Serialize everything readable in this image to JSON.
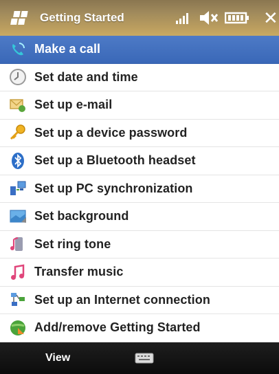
{
  "window": {
    "title": "Getting Started",
    "close_label": "✕"
  },
  "colors": {
    "selected_row": "#3a68b8",
    "title_bar": "#b69a5e",
    "soft_bar": "#111111"
  },
  "list": {
    "selected_index": 0,
    "items": [
      {
        "label": "Make a call",
        "icon": "phone-call-icon"
      },
      {
        "label": "Set date and time",
        "icon": "clock-icon"
      },
      {
        "label": "Set up e-mail",
        "icon": "email-icon"
      },
      {
        "label": "Set up a device password",
        "icon": "key-icon"
      },
      {
        "label": "Set up a Bluetooth headset",
        "icon": "bluetooth-icon"
      },
      {
        "label": "Set up PC synchronization",
        "icon": "pc-sync-icon"
      },
      {
        "label": "Set background",
        "icon": "background-image-icon"
      },
      {
        "label": "Set ring tone",
        "icon": "ring-tone-icon"
      },
      {
        "label": "Transfer music",
        "icon": "music-note-icon"
      },
      {
        "label": "Set up an Internet connection",
        "icon": "internet-connection-icon"
      },
      {
        "label": "Add/remove Getting Started",
        "icon": "globe-add-remove-icon"
      }
    ]
  },
  "softkeys": {
    "left_label": "View",
    "center_icon": "keyboard-icon"
  }
}
